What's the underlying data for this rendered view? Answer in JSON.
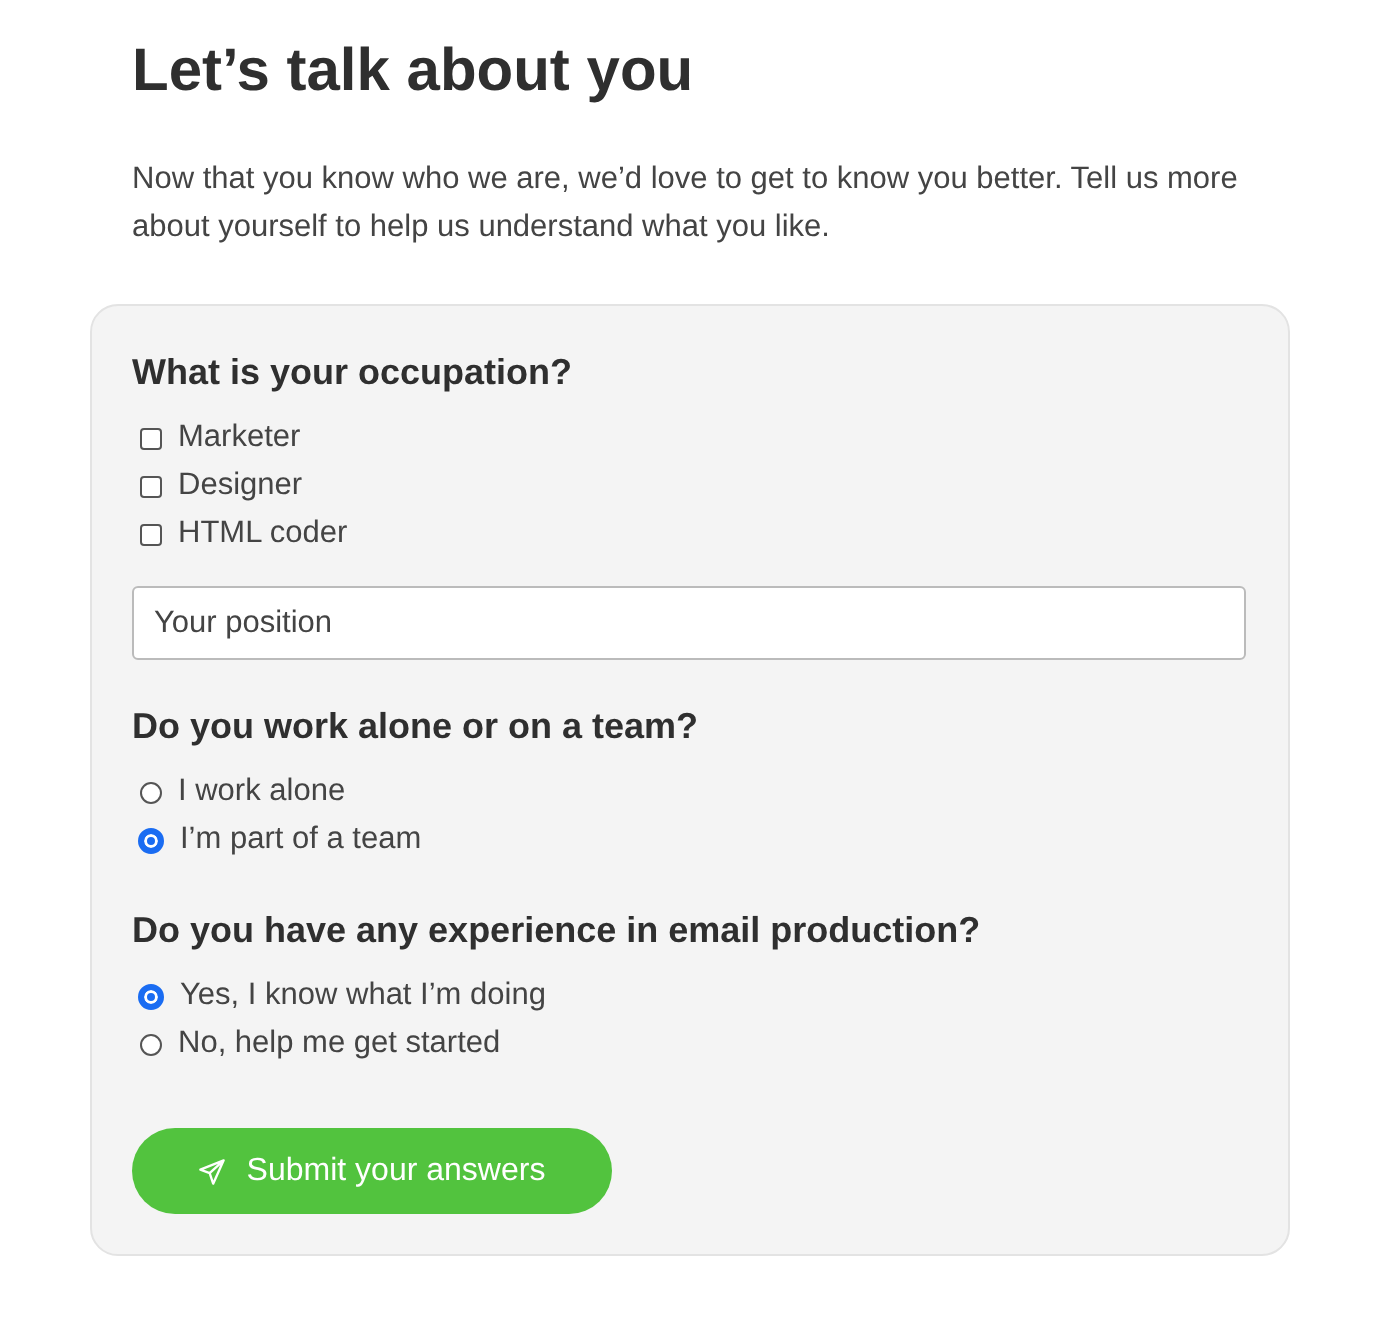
{
  "title": "Let’s talk about you",
  "intro": "Now that you know who we are, we’d love to get to know you better. Tell us more about yourself to help us understand what you like.",
  "questions": [
    {
      "kind": "checkbox",
      "question": "What is your occupation?",
      "options": [
        {
          "label": "Marketer",
          "checked": false
        },
        {
          "label": "Designer",
          "checked": false
        },
        {
          "label": "HTML coder",
          "checked": false
        }
      ],
      "field": {
        "placeholder": "Your position"
      }
    },
    {
      "kind": "radio",
      "question": "Do you work alone or on a team?",
      "options": [
        {
          "label": "I work alone",
          "selected": false
        },
        {
          "label": "I’m part of a team",
          "selected": true
        }
      ]
    },
    {
      "kind": "radio",
      "question": "Do you have any experience in email production?",
      "options": [
        {
          "label": "Yes, I know what I’m doing",
          "selected": true
        },
        {
          "label": "No, help me get started",
          "selected": false
        }
      ]
    }
  ],
  "submit": {
    "label": "Submit your answers"
  }
}
